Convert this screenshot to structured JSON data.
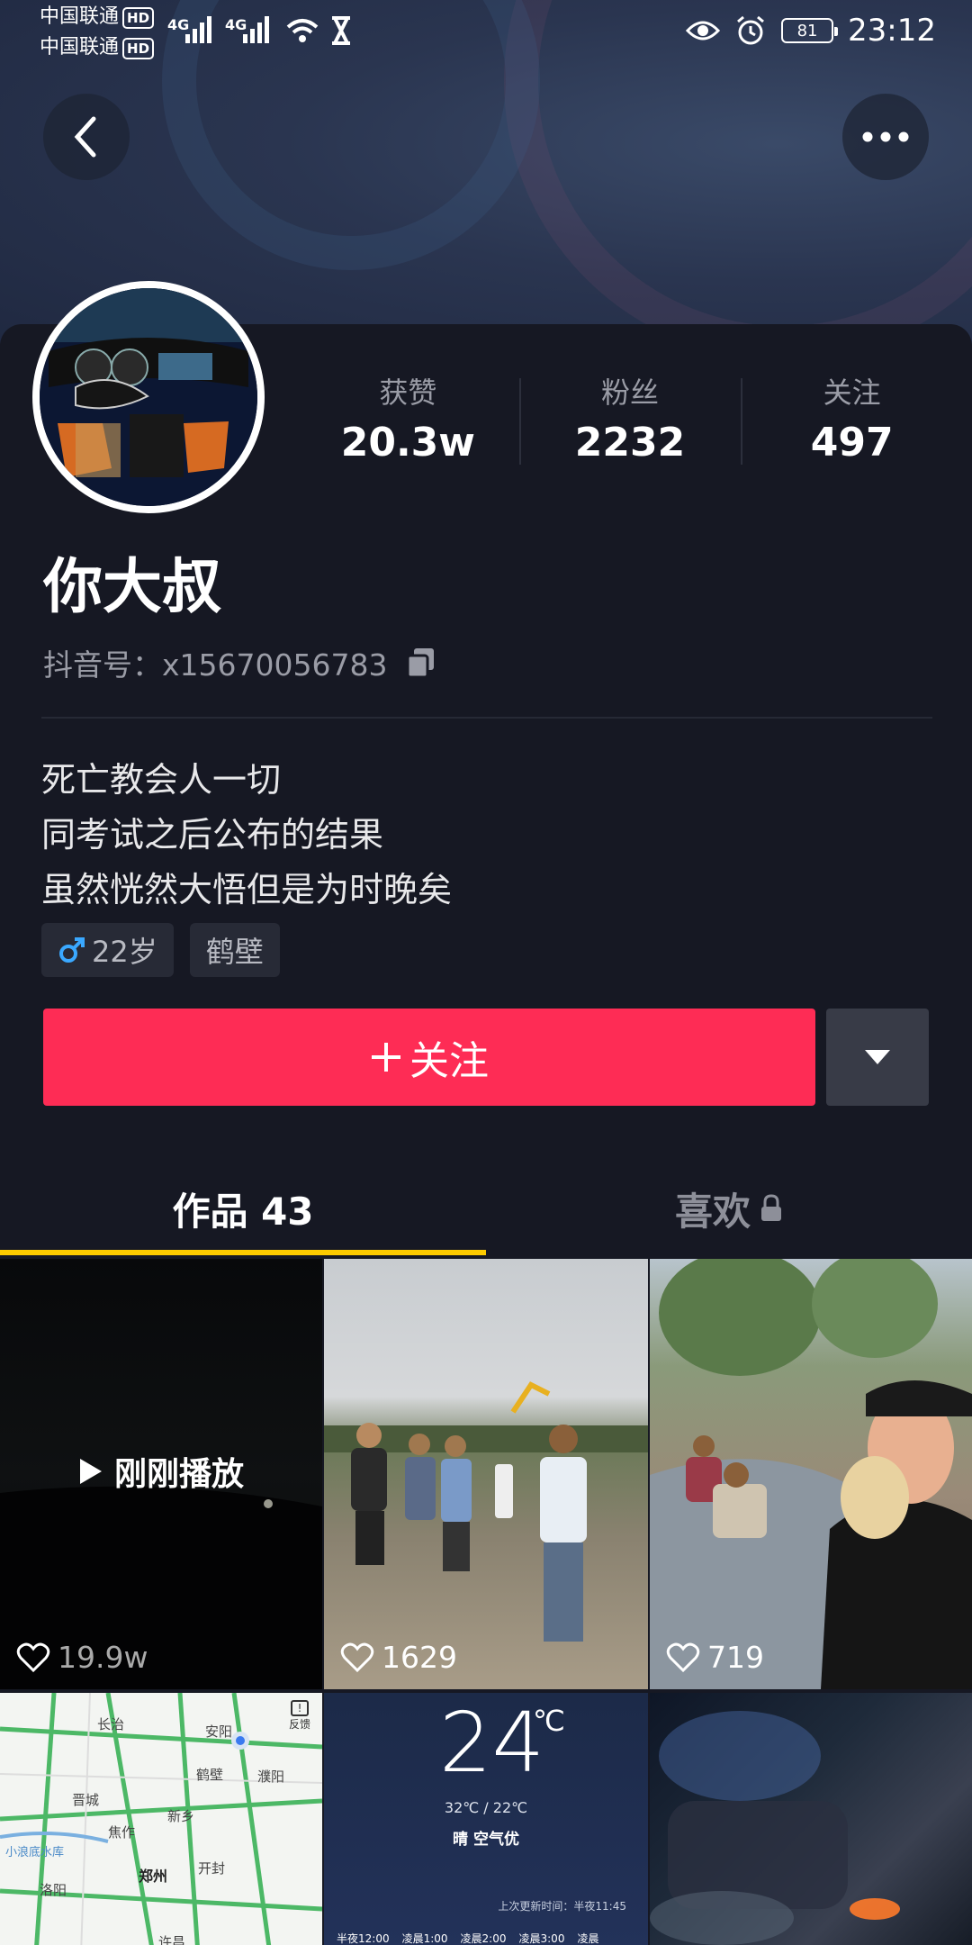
{
  "status_bar": {
    "carrier1": "中国联通",
    "carrier2": "中国联通",
    "hd": "HD",
    "net1": "4G",
    "net2": "4G",
    "battery": "81",
    "time": "23:12"
  },
  "header": {
    "back_icon": "chevron-left-icon",
    "more_icon": "ellipsis-icon"
  },
  "profile": {
    "stats": [
      {
        "label": "获赞",
        "value": "20.3w"
      },
      {
        "label": "粉丝",
        "value": "2232"
      },
      {
        "label": "关注",
        "value": "497"
      }
    ],
    "nickname": "你大叔",
    "douyin_id": "抖音号：x15670056783",
    "bio": [
      "死亡教会人一切",
      "同考试之后公布的结果",
      "虽然恍然大悟但是为时晚矣"
    ],
    "tags": {
      "age": "22岁",
      "location": "鹤壁"
    },
    "follow_label": "关注"
  },
  "tabs": [
    {
      "label": "作品 43"
    },
    {
      "label": "喜欢"
    }
  ],
  "videos": [
    {
      "likes": "19.9w",
      "overlay": "刚刚播放"
    },
    {
      "likes": "1629"
    },
    {
      "likes": "719"
    }
  ],
  "weather_thumb": {
    "temp": "24",
    "unit": "℃",
    "range": "32℃ / 22℃",
    "desc": "晴 空气优",
    "updated": "上次更新时间：半夜11:45",
    "times": [
      "半夜12:00",
      "凌晨1:00",
      "凌晨2:00",
      "凌晨3:00",
      "凌晨"
    ]
  },
  "map_thumb": {
    "labels": [
      "长治",
      "安阳",
      "鹤壁",
      "濮阳",
      "晋城",
      "焦作",
      "新乡",
      "郑州",
      "开封",
      "洛阳",
      "小浪底水库",
      "许昌"
    ],
    "report": "反馈"
  },
  "colors": {
    "accent": "#fe2c55",
    "tab_indicator": "#fcca00",
    "background": "#161823"
  }
}
